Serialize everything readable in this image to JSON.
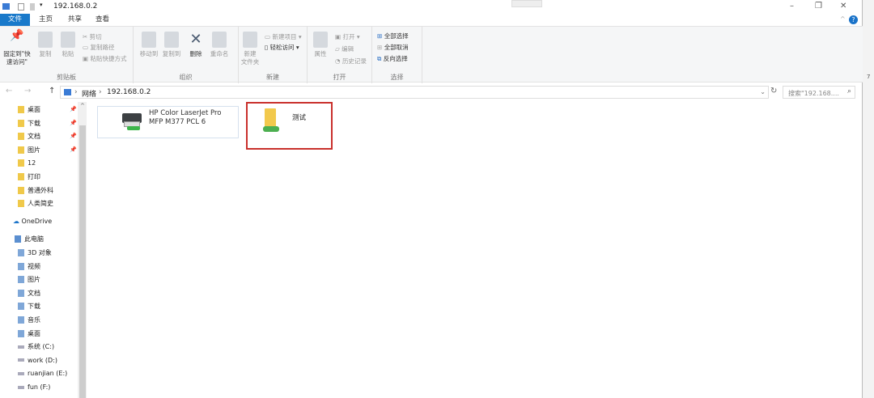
{
  "window": {
    "title": "192.168.0.2",
    "minimize": "–",
    "restore": "❐",
    "close": "✕",
    "help": "?"
  },
  "tabs": [
    {
      "label": "文件"
    },
    {
      "label": "主页"
    },
    {
      "label": "共享"
    },
    {
      "label": "查看"
    }
  ],
  "ribbon": {
    "clipboard": {
      "label": "剪贴板",
      "pin": "固定到\"快速访问\"",
      "copy": "复制",
      "paste": "粘贴",
      "cut": "剪切",
      "copy_path": "复制路径",
      "paste_shortcut": "粘贴快捷方式"
    },
    "organize": {
      "label": "组织",
      "move_to": "移动到",
      "copy_to": "复制到",
      "delete": "删除",
      "rename": "重命名"
    },
    "new": {
      "label": "新建",
      "new_folder": "新建\n文件夹",
      "new_item": "新建项目",
      "easy_access": "轻松访问"
    },
    "open": {
      "label": "打开",
      "properties": "属性",
      "open": "打开",
      "edit": "编辑",
      "history": "历史记录"
    },
    "select": {
      "label": "选择",
      "select_all": "全部选择",
      "select_none": "全部取消",
      "invert": "反向选择"
    }
  },
  "address": {
    "segments": [
      "网络",
      "192.168.0.2"
    ],
    "search_placeholder": "搜索\"192.168...."
  },
  "nav": {
    "quick": [
      {
        "label": "桌面",
        "pinned": true
      },
      {
        "label": "下载",
        "pinned": true
      },
      {
        "label": "文档",
        "pinned": true
      },
      {
        "label": "图片",
        "pinned": true
      },
      {
        "label": "12"
      },
      {
        "label": "打印"
      },
      {
        "label": "普通外科"
      },
      {
        "label": "人类简史"
      }
    ],
    "onedrive": "OneDrive",
    "pc": "此电脑",
    "pc_items": [
      {
        "label": "3D 对象"
      },
      {
        "label": "视频"
      },
      {
        "label": "图片"
      },
      {
        "label": "文档"
      },
      {
        "label": "下载"
      },
      {
        "label": "音乐"
      },
      {
        "label": "桌面"
      },
      {
        "label": "系统 (C:)"
      },
      {
        "label": "work (D:)"
      },
      {
        "label": "ruanjian (E:)"
      },
      {
        "label": "fun (F:)"
      }
    ]
  },
  "content": {
    "items": [
      {
        "name_line1": "HP Color LaserJet Pro",
        "name_line2": "MFP M377 PCL 6",
        "type": "printer"
      },
      {
        "name_line1": "测试",
        "type": "shared-folder"
      }
    ]
  },
  "side_number": "7"
}
